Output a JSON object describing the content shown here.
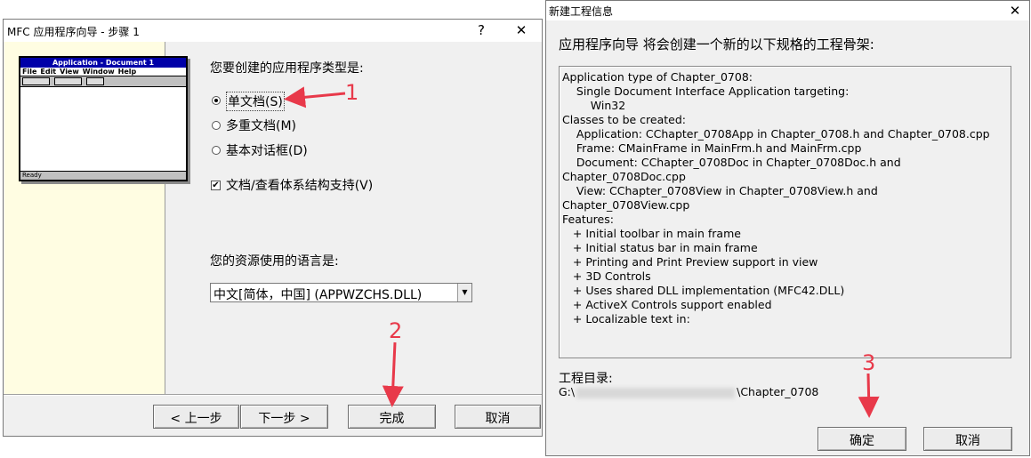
{
  "wizard": {
    "title": "MFC 应用程序向导 - 步骤 1",
    "help_button": "?",
    "close_button": "✕",
    "preview": {
      "title": "Application - Document 1",
      "menu": [
        "File",
        "Edit",
        "View",
        "Window",
        "Help"
      ],
      "status": "Ready"
    },
    "app_type_question": "您要创建的应用程序类型是:",
    "options": [
      {
        "label": "单文档(S)",
        "selected": true
      },
      {
        "label": "多重文档(M)",
        "selected": false
      },
      {
        "label": "基本对话框(D)",
        "selected": false
      }
    ],
    "docview_label": "文档/查看体系结构支持(V)",
    "docview_checked": true,
    "language_question": "您的资源使用的语言是:",
    "language_value": "中文[简体，中国] (APPWZCHS.DLL)",
    "buttons": {
      "back": "< 上一步",
      "next": "下一步 >",
      "finish": "完成",
      "cancel": "取消"
    }
  },
  "new_project_info": {
    "title": "新建工程信息",
    "close_button": "✕",
    "intro": "应用程序向导 将会创建一个新的以下规格的工程骨架:",
    "summary_lines": [
      "Application type of Chapter_0708:",
      "    Single Document Interface Application targeting:",
      "        Win32",
      "",
      "Classes to be created:",
      "    Application: CChapter_0708App in Chapter_0708.h and Chapter_0708.cpp",
      "    Frame: CMainFrame in MainFrm.h and MainFrm.cpp",
      "    Document: CChapter_0708Doc in Chapter_0708Doc.h and",
      "Chapter_0708Doc.cpp",
      "    View: CChapter_0708View in Chapter_0708View.h and",
      "Chapter_0708View.cpp",
      "",
      "Features:",
      "   + Initial toolbar in main frame",
      "   + Initial status bar in main frame",
      "   + Printing and Print Preview support in view",
      "   + 3D Controls",
      "   + Uses shared DLL implementation (MFC42.DLL)",
      "   + ActiveX Controls support enabled",
      "   + Localizable text in:"
    ],
    "dir_label": "工程目录:",
    "dir_prefix": "G:\\",
    "dir_suffix": "\\Chapter_0708",
    "buttons": {
      "ok": "确定",
      "cancel": "取消"
    }
  },
  "annotations": [
    "1",
    "2",
    "3"
  ],
  "colors": {
    "annotation_red": "#e8394a",
    "preview_title_bg": "#0000a8",
    "sidebar_bg": "#fffde2"
  }
}
